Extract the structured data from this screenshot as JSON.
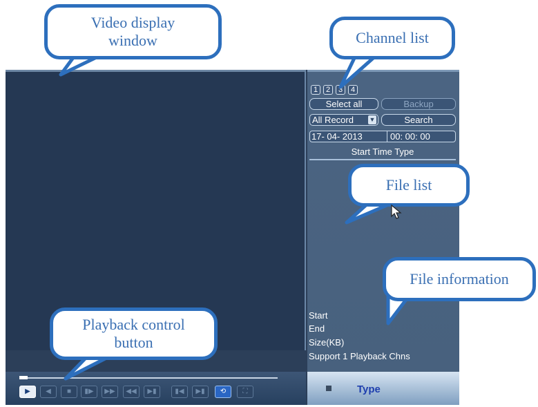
{
  "callouts": {
    "video": "Video display window",
    "channel": "Channel list",
    "file_list": "File list",
    "file_info": "File information",
    "playback": "Playback control button"
  },
  "channels": [
    "1",
    "2",
    "3",
    "4"
  ],
  "buttons": {
    "select_all": "Select all",
    "backup": "Backup",
    "record_type": "All Record",
    "search": "Search"
  },
  "date": "17- 04- 2013",
  "time": "00: 00: 00",
  "list_header": "Start Time Type",
  "file_info": {
    "start": "Start",
    "end": "End",
    "size": "Size(KB)",
    "support": "Support 1 Playback Chns"
  },
  "type_label": "Type",
  "colors": {
    "accent": "#2d6fbd",
    "panel": "#4b6482",
    "video_bg": "#253853"
  }
}
